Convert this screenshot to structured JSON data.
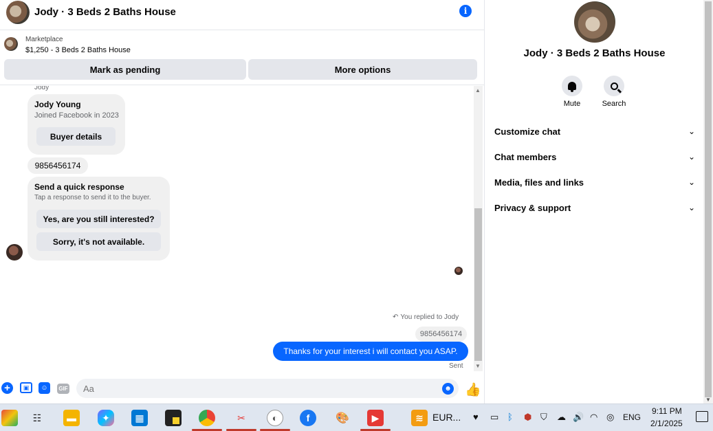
{
  "header": {
    "title": "Jody · 3 Beds 2 Baths House",
    "info_icon": "info-icon"
  },
  "marketplace": {
    "label": "Marketplace",
    "listing": "$1,250 - 3 Beds 2 Baths House",
    "mark_pending": "Mark as pending",
    "more_options": "More options"
  },
  "messages": {
    "sender_name": "Jody",
    "profile_card": {
      "name": "Jody Young",
      "joined": "Joined Facebook in 2023",
      "button": "Buyer details"
    },
    "phone_message": "9856456174",
    "quick_response": {
      "title": "Send a quick response",
      "subtitle": "Tap a response to send it to the buyer.",
      "option1": "Yes, are you still interested?",
      "option2": "Sorry, it's not available."
    },
    "replied_to": "You replied to Jody",
    "quoted": "9856456174",
    "my_message": "Thanks for your interest i will contact you ASAP.",
    "status": "Sent"
  },
  "composer": {
    "placeholder": "Aa",
    "accent": "#0866ff"
  },
  "panel": {
    "name": "Jody · 3 Beds 2 Baths House",
    "mute_label": "Mute",
    "search_label": "Search",
    "sections": [
      "Customize chat",
      "Chat members",
      "Media, files and links",
      "Privacy & support"
    ]
  },
  "taskbar": {
    "window_label": "EUR...",
    "language": "ENG",
    "time": "9:11 PM",
    "date": "2/1/2025"
  }
}
